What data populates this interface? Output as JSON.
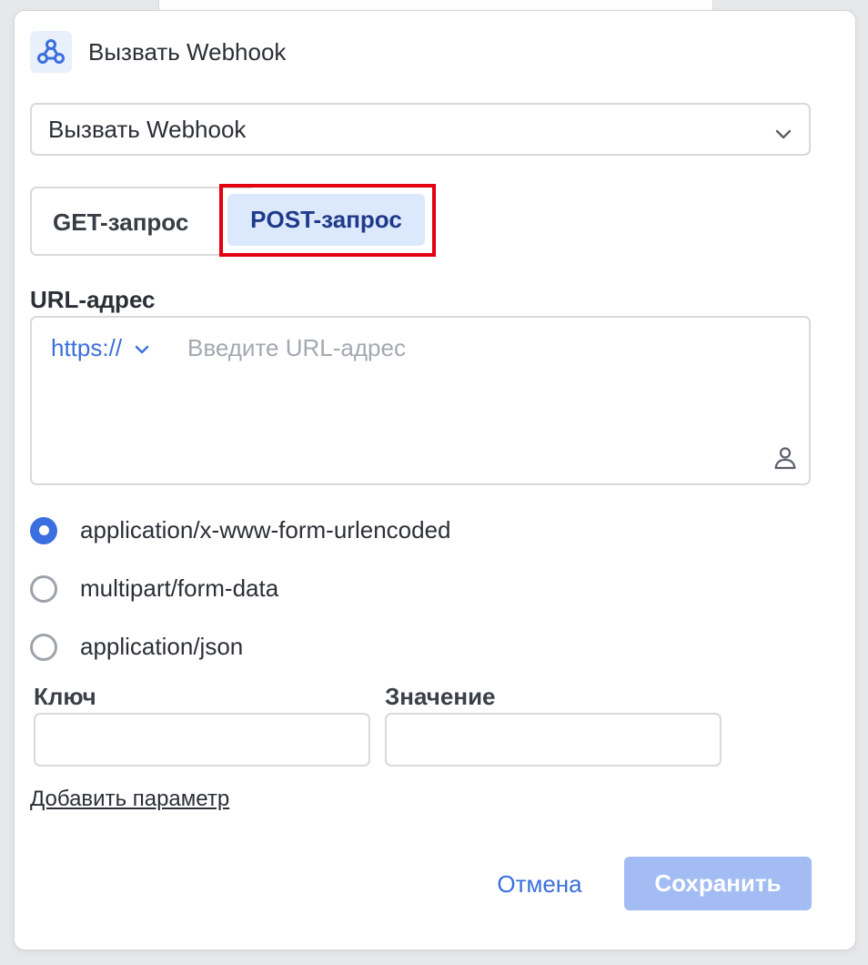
{
  "header": {
    "icon": "webhook-icon",
    "title": "Вызвать Webhook"
  },
  "action_select": {
    "value": "Вызвать Webhook",
    "icon": "chevron-down-icon"
  },
  "request_tabs": {
    "get_label": "GET-запрос",
    "post_label": "POST-запрос",
    "selected": "POST-запрос"
  },
  "url": {
    "label": "URL-адрес",
    "protocol": "https://",
    "placeholder": "Введите URL-адрес",
    "value": "",
    "variable_icon": "person-icon"
  },
  "content_types": [
    {
      "label": "application/x-www-form-urlencoded",
      "checked": true
    },
    {
      "label": "multipart/form-data",
      "checked": false
    },
    {
      "label": "application/json",
      "checked": false
    }
  ],
  "params": {
    "key_label": "Ключ",
    "value_label": "Значение",
    "key_value": "",
    "value_value": "",
    "add_label": "Добавить параметр"
  },
  "footer": {
    "cancel_label": "Отмена",
    "save_label": "Сохранить"
  },
  "colors": {
    "accent": "#3b6fe0",
    "tab_selected_bg": "#dce8fb",
    "highlight_border": "#e3000f",
    "save_disabled_bg": "#a3bcf3"
  }
}
